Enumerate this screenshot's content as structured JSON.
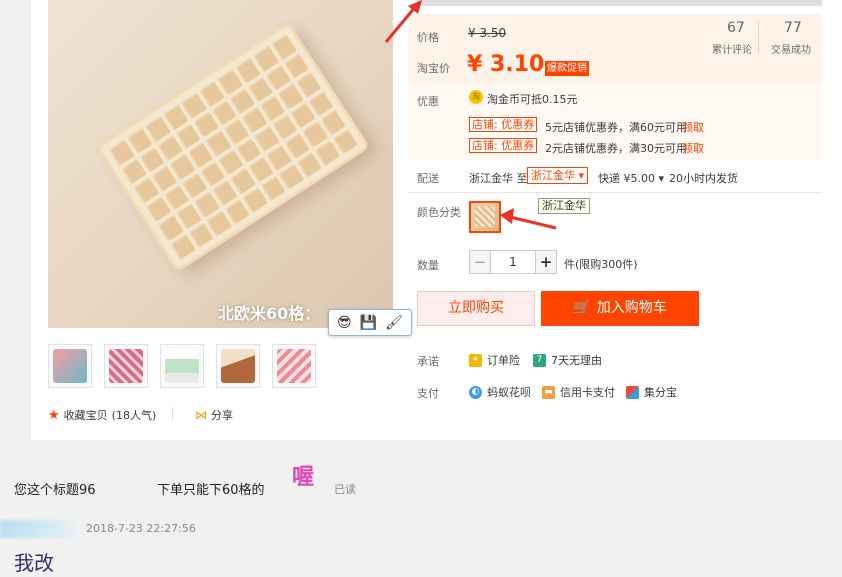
{
  "product": {
    "image_caption": "北欧米60格：",
    "collect_label": "收藏宝贝",
    "collect_count": "(18人气)",
    "share_label": "分享"
  },
  "price": {
    "label": "价格",
    "old_price": "¥ 3.50",
    "tb_label": "淘宝价",
    "tb_price": "¥ 3.10",
    "badge": "爆款促销",
    "reviews_count": "67",
    "reviews_label": "累计评论",
    "deals_count": "77",
    "deals_label": "交易成功"
  },
  "promo": {
    "label": "优惠",
    "coin_icon": "淘",
    "coin_text": "淘金币可抵0.15元",
    "coupons": [
      {
        "tag": "店铺: 优惠券",
        "text": "5元店铺优惠券，满60元可用",
        "action": "领取"
      },
      {
        "tag": "店铺: 优惠券",
        "text": "2元店铺优惠券，满30元可用",
        "action": "领取"
      }
    ]
  },
  "shipping": {
    "label": "配送",
    "from": "浙江金华 至",
    "to": "浙江金华 ▾",
    "express": "快递 ¥5.00 ▾",
    "time": "20小时内发货"
  },
  "color": {
    "label": "颜色分类",
    "tooltip": "浙江金华"
  },
  "quantity": {
    "label": "数量",
    "minus": "−",
    "value": "1",
    "plus": "+",
    "limit": "件(限购300件)"
  },
  "actions": {
    "buy_now": "立即购买",
    "add_cart": "加入购物车"
  },
  "service": {
    "promise_label": "承诺",
    "promise_items": [
      "订单险",
      "7天无理由"
    ],
    "pay_label": "支付",
    "pay_items": [
      "蚂蚁花呗",
      "信用卡支付",
      "集分宝"
    ]
  },
  "chat": {
    "message_part1": "您这个标题96",
    "message_part2": "下单只能下60格的",
    "emoji": "喔",
    "read_status": "已读",
    "timestamp": "2018-7-23 22:27:56",
    "reply": "我改"
  },
  "colors": {
    "accent": "#ff4400",
    "price_bg": "#fff2e8"
  }
}
